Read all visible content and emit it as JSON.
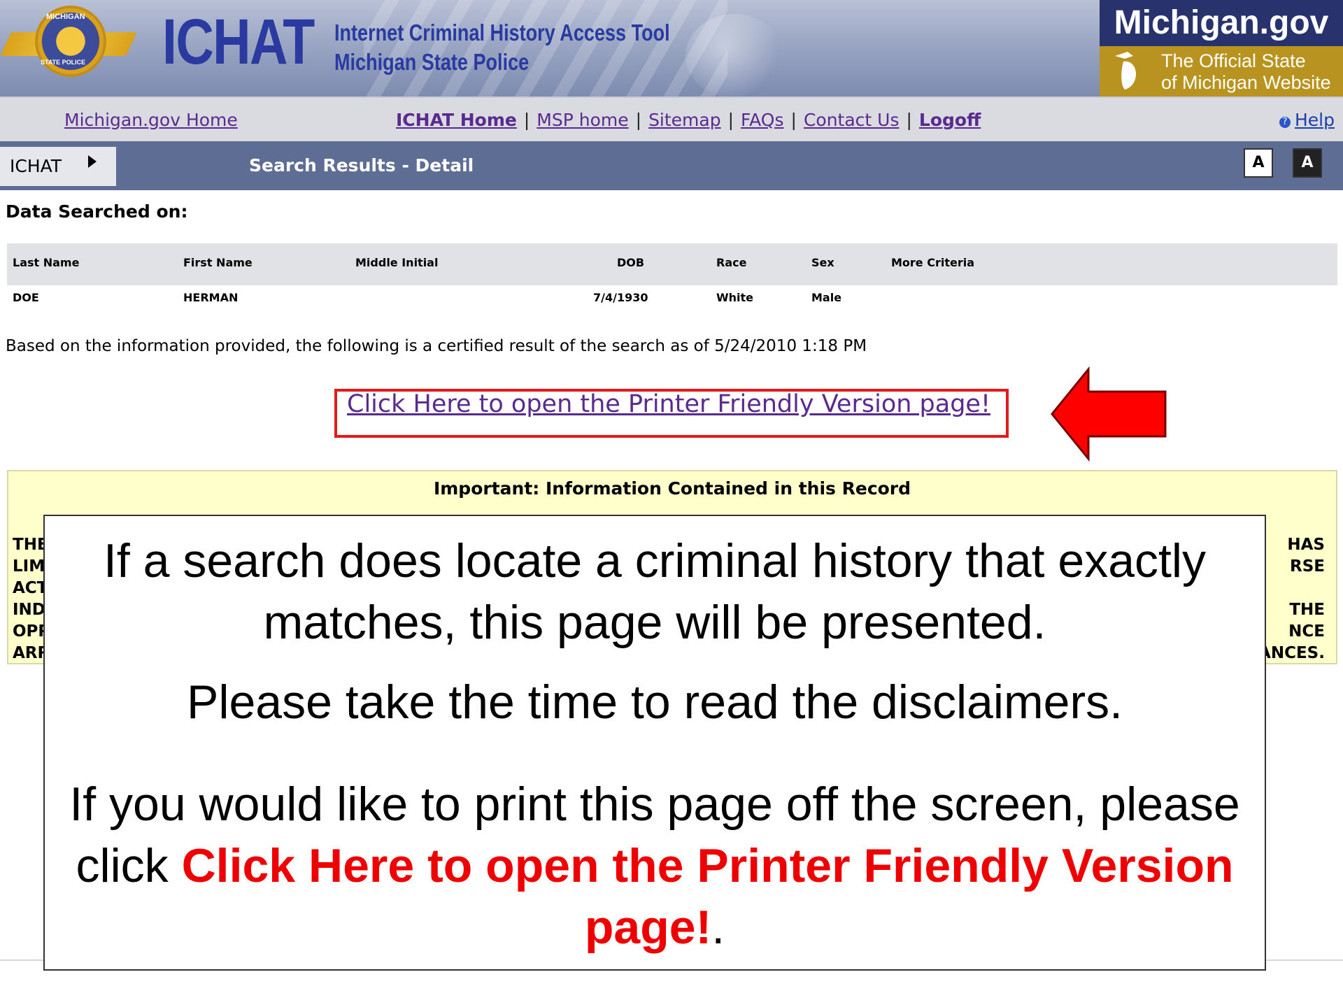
{
  "banner": {
    "logo": "ICHAT",
    "subtitle_line1": "Internet Criminal History Access Tool",
    "subtitle_line2": "Michigan State Police",
    "seal_top": "MICHIGAN",
    "seal_bottom": "STATE POLICE",
    "mi_site": "Michigan.gov",
    "mi_tagline_line1": "The Official State",
    "mi_tagline_line2": "of Michigan Website"
  },
  "nav": {
    "home": "Michigan.gov Home",
    "links": [
      "ICHAT Home",
      "MSP home",
      "Sitemap",
      "FAQs",
      "Contact Us",
      "Logoff"
    ],
    "help": "Help"
  },
  "breadcrumb": {
    "tab": "ICHAT",
    "title": "Search Results - Detail",
    "font_small": "A",
    "font_large": "A"
  },
  "search": {
    "heading": "Data Searched on:",
    "headers": [
      "Last Name",
      "First Name",
      "Middle Initial",
      "DOB",
      "Race",
      "Sex",
      "More Criteria"
    ],
    "values": [
      "DOE",
      "HERMAN",
      "",
      "7/4/1930",
      "White",
      "Male",
      ""
    ],
    "certified_text": "Based on the information provided, the following is a certified result of the search as of 5/24/2010 1:18 PM",
    "printer_link": "Click Here to open the Printer Friendly Version page!"
  },
  "important": {
    "title": "Important:  Information Contained in this Record",
    "left_fragments": [
      "THE",
      "LIM",
      "ACT",
      "IND",
      "OPP",
      "ARR"
    ],
    "right_fragments": [
      "HAS",
      "RSE",
      "",
      "THE",
      "NCE",
      "ANCES."
    ]
  },
  "callout": {
    "p1": "If a search does locate a criminal history that exactly matches, this page will be presented.",
    "p2": "Please take the time to read the disclaimers.",
    "p3_before": "If you would like to print this page off the screen, please click ",
    "p3_link": "Click Here to open the Printer Friendly Version page!",
    "p3_after": "."
  },
  "colors": {
    "banner_blue": "#2a3aa0",
    "link_purple": "#5b2a8f",
    "breadcrumb_bar": "#5e6d93",
    "highlight_red": "#e31a1a",
    "notice_yellow": "#ffffcc",
    "mi_gold": "#b89320",
    "mi_navy": "#28336e"
  }
}
